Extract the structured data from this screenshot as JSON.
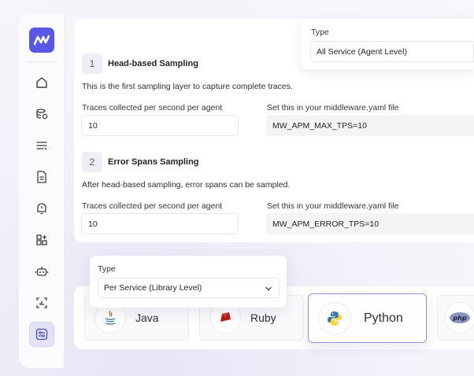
{
  "sidebar": {
    "logo_icon": "middleware-logo-icon",
    "items": [
      {
        "name": "home-icon"
      },
      {
        "name": "database-icon"
      },
      {
        "name": "filter-lines-icon"
      },
      {
        "name": "document-icon"
      },
      {
        "name": "alert-bell-icon"
      },
      {
        "name": "add-widget-icon"
      },
      {
        "name": "robot-icon"
      },
      {
        "name": "user-analytics-icon"
      },
      {
        "name": "settings-sliders-icon",
        "active": true
      }
    ],
    "accent": "#5b57e6"
  },
  "type_top": {
    "label": "Type",
    "value": "All Service (Agent Level)"
  },
  "head_sampling": {
    "step": "1",
    "title": "Head-based Sampling",
    "description": "This is the first sampling layer to capture complete traces.",
    "traces_label": "Traces collected per second per agent",
    "traces_value": "10",
    "config_label": "Set this in your middleware.yaml file",
    "config_value": "MW_APM_MAX_TPS=10"
  },
  "error_sampling": {
    "step": "2",
    "title": "Error Spans Sampling",
    "description": "After head-based sampling, error spans can be sampled.",
    "traces_label": "Traces collected per second per agent",
    "traces_value": "10",
    "config_label": "Set this in your middleware.yaml file",
    "config_value": "MW_APM_ERROR_TPS=10"
  },
  "type_bottom": {
    "label": "Type",
    "value": "Per Service (Library Level)"
  },
  "languages": [
    {
      "name": "Java",
      "icon": "java-icon"
    },
    {
      "name": "Ruby",
      "icon": "ruby-icon"
    },
    {
      "name": "Python",
      "icon": "python-icon",
      "selected": true
    },
    {
      "name": "",
      "icon": "php-icon"
    }
  ],
  "php_logo_text": "php"
}
